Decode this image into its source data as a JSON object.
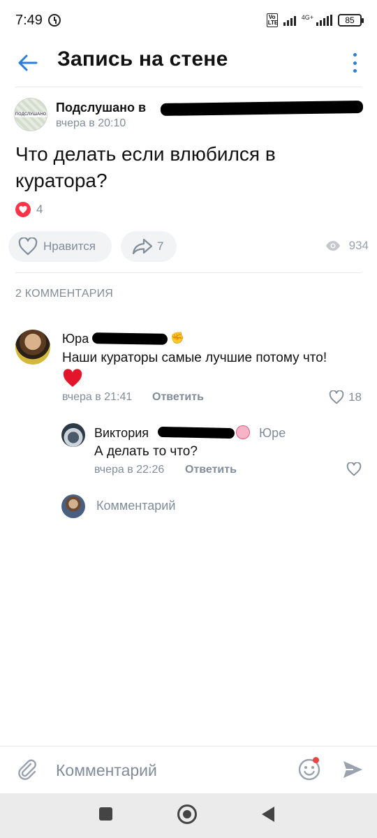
{
  "status_bar": {
    "time": "7:49",
    "volte": "Vo LTE",
    "network": "4G+",
    "battery": "85"
  },
  "header": {
    "title": "Запись на стене"
  },
  "post": {
    "author": "Подслушано в",
    "avatar_text": "ПОДСЛУШАНО",
    "time": "вчера в 20:10",
    "text": "Что делать если влюбился в куратора?",
    "reaction_count": "4",
    "like_label": "Нравится",
    "share_count": "7",
    "views": "934"
  },
  "comments_header": "2 КОММЕНТАРИЯ",
  "comments": [
    {
      "name": "Юра",
      "text": "Наши кураторы самые лучшие потому что!",
      "time": "вчера в 21:41",
      "reply_label": "Ответить",
      "likes": "18"
    },
    {
      "name": "Виктория",
      "reply_to": "Юре",
      "text": "А делать то что?",
      "time": "вчера в 22:26",
      "reply_label": "Ответить"
    }
  ],
  "inline_comment": {
    "placeholder": "Комментарий"
  },
  "bottom_input": {
    "placeholder": "Комментарий"
  },
  "colors": {
    "accent": "#2a7ed6",
    "secondary_text": "#818c99",
    "like_red": "#ff3347"
  },
  "icons": [
    "back-arrow-icon",
    "more-vertical-icon",
    "heart-icon",
    "share-icon",
    "eye-icon",
    "paperclip-icon",
    "smile-icon",
    "send-icon"
  ]
}
